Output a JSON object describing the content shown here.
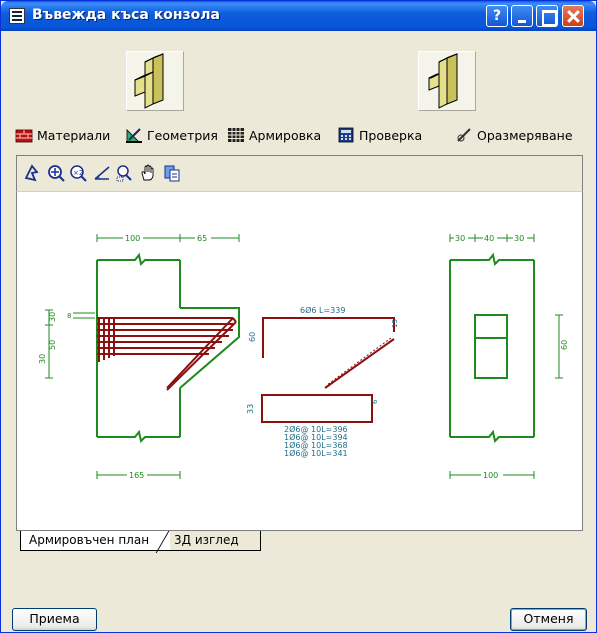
{
  "window": {
    "title": "Въвежда къса конзола"
  },
  "titlebar_buttons": {
    "help": "?"
  },
  "menu": {
    "items": [
      {
        "label": "Материали",
        "icon": "bricks-icon"
      },
      {
        "label": "Геометрия",
        "icon": "ruler-pencil-icon"
      },
      {
        "label": "Армировка",
        "icon": "grid-icon"
      },
      {
        "label": "Проверка",
        "icon": "calculator-icon"
      },
      {
        "label": "Оразмеряване",
        "icon": "pen-icon"
      }
    ]
  },
  "tools": [
    "pan-tool-icon",
    "zoom-fit-icon",
    "zoom-x2-icon",
    "measure-icon",
    "zoom-window-icon",
    "hand-icon",
    "copy-icon"
  ],
  "drawing": {
    "left_dims": {
      "top_a": "100",
      "top_b": "65",
      "bottom": "165",
      "side_a": "30",
      "side_b": "50",
      "side_c": "30",
      "small": "8"
    },
    "middle": {
      "bar1": "6Ø6 L=339",
      "h1": "60",
      "h2": "33",
      "small1": "15",
      "small2": "6",
      "bars": [
        "2Ø6@ 10L=396",
        "1Ø6@ 10L=394",
        "1Ø6@ 10L=368",
        "1Ø6@ 10L=341"
      ]
    },
    "right_dims": {
      "top_a": "30",
      "top_b": "40",
      "top_c": "30",
      "bottom": "100",
      "side": "60"
    }
  },
  "tabs": [
    {
      "label": "Армировъчен план",
      "active": true
    },
    {
      "label": "3Д изглед",
      "active": false
    }
  ],
  "buttons": {
    "ok": "Приема",
    "cancel": "Отменя"
  },
  "colors": {
    "green": "#1E8A1E",
    "red": "#8B1010",
    "blue": "#1F6F8B",
    "title_blue": "#0755D8"
  }
}
